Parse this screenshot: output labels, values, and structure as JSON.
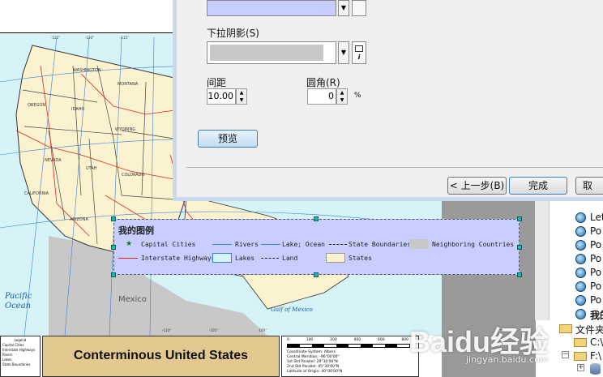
{
  "map": {
    "title": "Conterminous United States",
    "ocean_label": "Pacific\nOcean",
    "mexico_label": "Mexico",
    "gulf_label": "Gulf of Mexico",
    "states": [
      "WASHINGTON",
      "MONTANA",
      "OREGON",
      "IDAHO",
      "WYOMING",
      "NEVADA",
      "UTAH",
      "COLORADO",
      "CALIFORNIA",
      "ARIZONA"
    ],
    "small_legend": [
      "Legend",
      "Capital Cities",
      "Interstate Highways",
      "Rivers",
      "Lakes",
      "State Boundaries"
    ],
    "scale_ticks": [
      "0",
      "100",
      "200",
      "400",
      "600",
      "800"
    ],
    "projection_lines": [
      "Coordinate System: Albers",
      "Central Meridian: -96°00'00\"",
      "1st Std Parallel: 29°30'00\"N",
      "2nd Std Parallel: 45°30'00\"N",
      "Latitude of Origin: 40°00'00\"N"
    ],
    "graticule_labels": [
      "-125°",
      "-120°",
      "-115°",
      "-110°",
      "-105°",
      "-100°"
    ]
  },
  "legend": {
    "title": "我的图例",
    "items": [
      {
        "label": "Capital Cities"
      },
      {
        "label": "Rivers"
      },
      {
        "label": "Lake; Ocean"
      },
      {
        "label": "State Boundaries"
      },
      {
        "label": "Neighboring Countries"
      },
      {
        "label": "Interstate Highways"
      },
      {
        "label": "Lakes"
      },
      {
        "label": "Land"
      },
      {
        "label": "States"
      }
    ]
  },
  "dialog": {
    "shadow_label": "下拉阴影(S)",
    "spacing_label": "间距",
    "spacing_value": "10.00",
    "corner_label": "圆角(R)",
    "corner_value": "0",
    "percent": "%",
    "preview_button": "预览",
    "back_button": "< 上一步(B)",
    "finish_button": "完成",
    "cancel_button": "取"
  },
  "tree": {
    "items": [
      "Let",
      "Po",
      "Po",
      "Po",
      "Po",
      "Po",
      "Po",
      "我的"
    ],
    "folder_root": "文件夹",
    "folder_c": "C:\\",
    "folder_f": "F:\\"
  },
  "watermark": {
    "brand": "Baidu经验",
    "url": "jingyan.baidu.com"
  },
  "colors": {
    "legend_bg": "#c8ceff",
    "land": "#fbf3cf",
    "ocean": "#d6f4f8",
    "dialog_border": "#cbd9ec"
  }
}
